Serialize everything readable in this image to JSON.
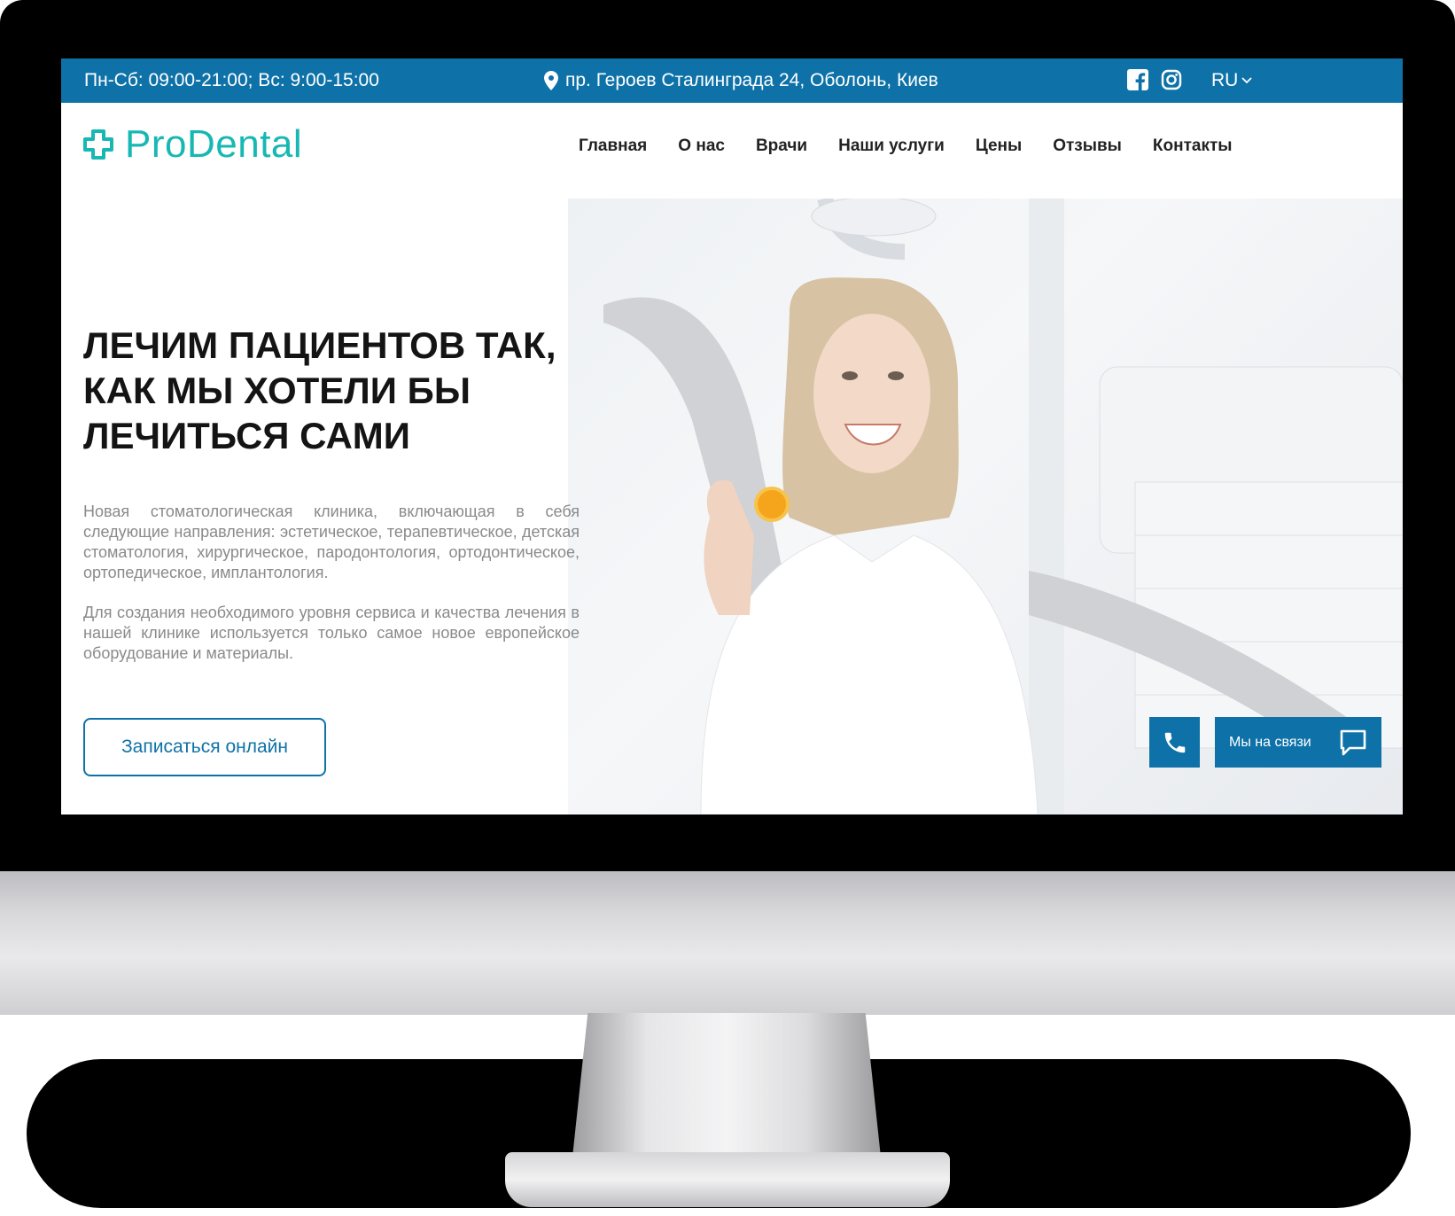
{
  "topbar": {
    "hours": "Пн-Сб: 09:00-21:00; Вс: 9:00-15:00",
    "address": "пр. Героев Сталинграда 24, Оболонь, Киев",
    "language": "RU",
    "social_icons": [
      "facebook-icon",
      "instagram-icon"
    ]
  },
  "header": {
    "logo_text": "ProDental",
    "nav": [
      "Главная",
      "О нас",
      "Врачи",
      "Наши услуги",
      "Цены",
      "Отзывы",
      "Контакты"
    ]
  },
  "hero": {
    "title_lines": [
      "ЛЕЧИМ ПАЦИЕНТОВ ТАК,",
      "КАК МЫ ХОТЕЛИ БЫ",
      "ЛЕЧИТЬСЯ САМИ"
    ],
    "paragraph1": "Новая стоматологическая клиника, включающая в себя следующие направления: эстетическое, терапевтическое, детская стоматология, хирургическое, пародонтология, ортодонтическое, ортопедическое, имплантология.",
    "paragraph2": "Для создания необходимого уровня сервиса и качества лечения в нашей клинике используется только самое новое европейское оборудование и материалы.",
    "cta_label": "Записаться онлайн",
    "contact_label": "Мы на связи"
  },
  "colors": {
    "brand_blue": "#0e72a8",
    "logo_teal": "#17b8b3",
    "text_dark": "#141414",
    "text_muted": "#8a8a8a"
  }
}
